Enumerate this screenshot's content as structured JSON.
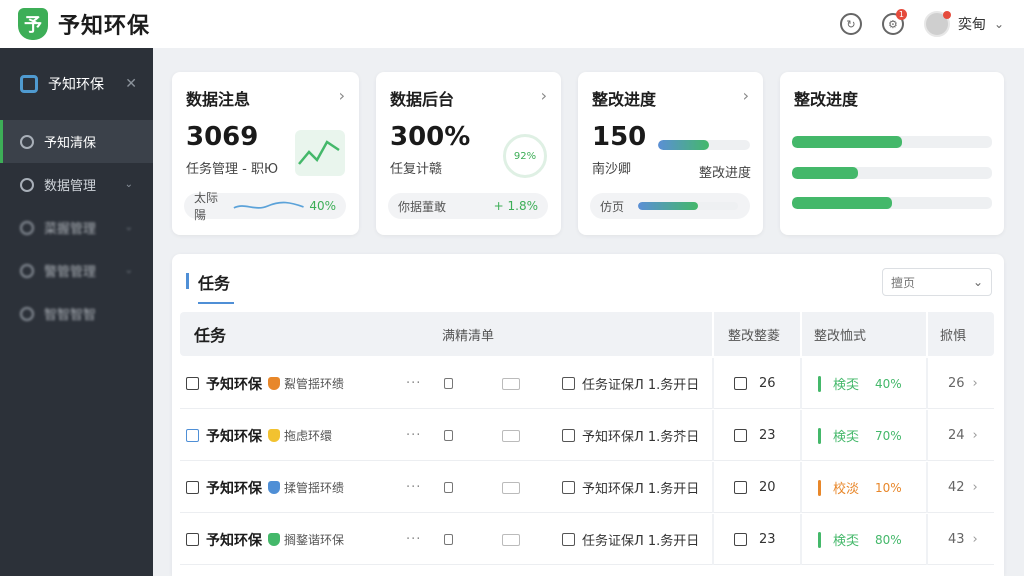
{
  "header": {
    "logo_char": "予",
    "brand": "予知环保",
    "notif_badge": "1",
    "user_name": "奕甸"
  },
  "sidebar": {
    "title": "予知环保",
    "items": [
      {
        "label": "予知清保",
        "active": true
      },
      {
        "label": "数据管理",
        "active": false
      },
      {
        "label": "菜握管理",
        "active": false
      },
      {
        "label": "警管管理",
        "active": false
      },
      {
        "label": "智智智智",
        "active": false
      }
    ]
  },
  "cards": [
    {
      "title": "数据注息",
      "value": "3069",
      "sub": "任务管理 - 职Ю",
      "pill": "太际陽",
      "pill_value": "40%"
    },
    {
      "title": "数据后台",
      "value": "300%",
      "sub": "任复计赣",
      "ring": "92%",
      "pill": "你据董敢",
      "pill_value": "+ 1.8%"
    },
    {
      "title": "整改进度",
      "value": "150",
      "sub": "南沙卿",
      "progress_label": "整改进度",
      "pill": "仿页"
    },
    {
      "title": "整改进度"
    }
  ],
  "card_progress": {
    "card3_top": 0.55,
    "card3_bottom": 0.6,
    "card4": [
      0.55,
      0.33,
      0.5
    ]
  },
  "panel": {
    "title": "任务",
    "select": "擅页"
  },
  "table": {
    "headers": [
      "任务",
      "满精清单",
      "整改整菱",
      "整改恤式",
      "掀惧"
    ],
    "rows": [
      {
        "name": "予知环保",
        "tag": "鮤管揺环缋",
        "shield": "#e8872a",
        "cb_blue": false,
        "date": "任务证保Л 1.务开日",
        "count": "26",
        "status": "検奀",
        "status_color": "#44b86a",
        "pct": "40%",
        "tail": "26"
      },
      {
        "name": "予知环保",
        "tag": "拖虑环缳",
        "shield": "#f2c230",
        "cb_blue": true,
        "date": "予知环保Л 1.务芥日",
        "count": "23",
        "status": "検奀",
        "status_color": "#44b86a",
        "pct": "70%",
        "tail": "24"
      },
      {
        "name": "予知环保",
        "tag": "揉管揺环缋",
        "shield": "#4f8fd6",
        "cb_blue": false,
        "date": "予知环保Л 1.务开日",
        "count": "20",
        "status": "校淡",
        "status_color": "#e8872a",
        "pct": "10%",
        "tail": "42"
      },
      {
        "name": "予知环保",
        "tag": "搁鍪谐环保",
        "shield": "#44b86a",
        "cb_blue": false,
        "date": "任务证保Л 1.务开日",
        "count": "23",
        "status": "検奀",
        "status_color": "#44b86a",
        "pct": "80%",
        "tail": "43"
      }
    ]
  }
}
